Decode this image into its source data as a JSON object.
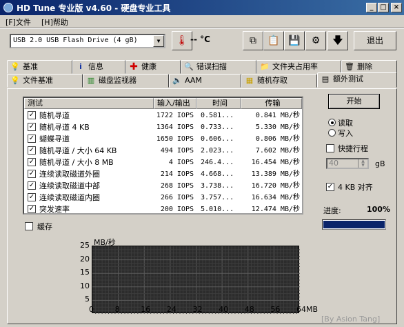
{
  "window": {
    "title": "HD Tune 专业版 v4.60 - 硬盘专业工具"
  },
  "window_controls": {
    "minimize": "_",
    "maximize": "□",
    "close": "×"
  },
  "menu": {
    "file": "[F]文件",
    "help": "[H]帮助"
  },
  "toolbar": {
    "drive": "USB 2.0 USB Flash Drive  (4 gB)",
    "temperature": "-- °C",
    "exit_label": "退出",
    "icons": [
      "thermometer-icon",
      "copy-icon",
      "paste-icon",
      "save-icon",
      "settings-icon",
      "download-icon"
    ]
  },
  "tabs_row1": [
    {
      "label": "基准",
      "icon": "bulb-icon"
    },
    {
      "label": "信息",
      "icon": "info-icon"
    },
    {
      "label": "健康",
      "icon": "plus-icon"
    },
    {
      "label": "错误扫描",
      "icon": "magnifier-icon"
    },
    {
      "label": "文件夹占用率",
      "icon": "folder-icon"
    },
    {
      "label": "删除",
      "icon": "trash-icon"
    }
  ],
  "tabs_row2": [
    {
      "label": "文件基准",
      "icon": "file-bulb-icon"
    },
    {
      "label": "磁盘监视器",
      "icon": "monitor-icon"
    },
    {
      "label": "AAM",
      "icon": "speaker-icon"
    },
    {
      "label": "随机存取",
      "icon": "random-icon"
    },
    {
      "label": "额外测试",
      "icon": "extra-icon",
      "active": true
    }
  ],
  "table": {
    "headers": [
      "测试",
      "输入/输出",
      "时间",
      "传输"
    ],
    "rows": [
      {
        "name": "随机寻道",
        "io": "1722 IOPS",
        "time": "0.581...",
        "transfer": "0.841 MB/秒",
        "checked": true
      },
      {
        "name": "随机寻道 4 KB",
        "io": "1364 IOPS",
        "time": "0.733...",
        "transfer": "5.330 MB/秒",
        "checked": true
      },
      {
        "name": "蝴蝶寻道",
        "io": "1650 IOPS",
        "time": "0.606...",
        "transfer": "0.806 MB/秒",
        "checked": true
      },
      {
        "name": "随机寻道 / 大小 64 KB",
        "io": "494 IOPS",
        "time": "2.023...",
        "transfer": "7.602 MB/秒",
        "checked": true
      },
      {
        "name": "随机寻道 / 大小 8 MB",
        "io": "4 IOPS",
        "time": "246.4...",
        "transfer": "16.454 MB/秒",
        "checked": true
      },
      {
        "name": "连续读取磁道外圈",
        "io": "214 IOPS",
        "time": "4.668...",
        "transfer": "13.389 MB/秒",
        "checked": true
      },
      {
        "name": "连续读取磁道中部",
        "io": "268 IOPS",
        "time": "3.738...",
        "transfer": "16.720 MB/秒",
        "checked": true
      },
      {
        "name": "连续读取磁道内圈",
        "io": "266 IOPS",
        "time": "3.757...",
        "transfer": "16.634 MB/秒",
        "checked": true
      },
      {
        "name": "突发速率",
        "io": "200 IOPS",
        "time": "5.010...",
        "transfer": "12.474 MB/秒",
        "checked": true
      }
    ]
  },
  "side": {
    "start_label": "开始",
    "read_label": "读取",
    "write_label": "写入",
    "mode": "read",
    "short_stroke_label": "快捷行程",
    "short_stroke_checked": false,
    "short_stroke_value": "40",
    "short_stroke_unit": "gB",
    "align_label": "4 KB 对齐",
    "align_checked": true,
    "progress_label": "进度:",
    "progress_value": "100%",
    "progress_fraction": 1.0
  },
  "cache": {
    "label": "缓存",
    "checked": false
  },
  "chart_data": {
    "type": "area",
    "title": "",
    "ylabel": "MB/秒",
    "xlabel": "",
    "x_ticks": [
      "0",
      "8",
      "16",
      "24",
      "32",
      "40",
      "48",
      "56",
      "64MB"
    ],
    "y_ticks": [
      "25",
      "20",
      "15",
      "10",
      "5"
    ],
    "ylim": [
      0,
      25
    ],
    "xlim": [
      0,
      64
    ],
    "grid": true,
    "series": []
  },
  "watermark": "[By Asion Tang]"
}
